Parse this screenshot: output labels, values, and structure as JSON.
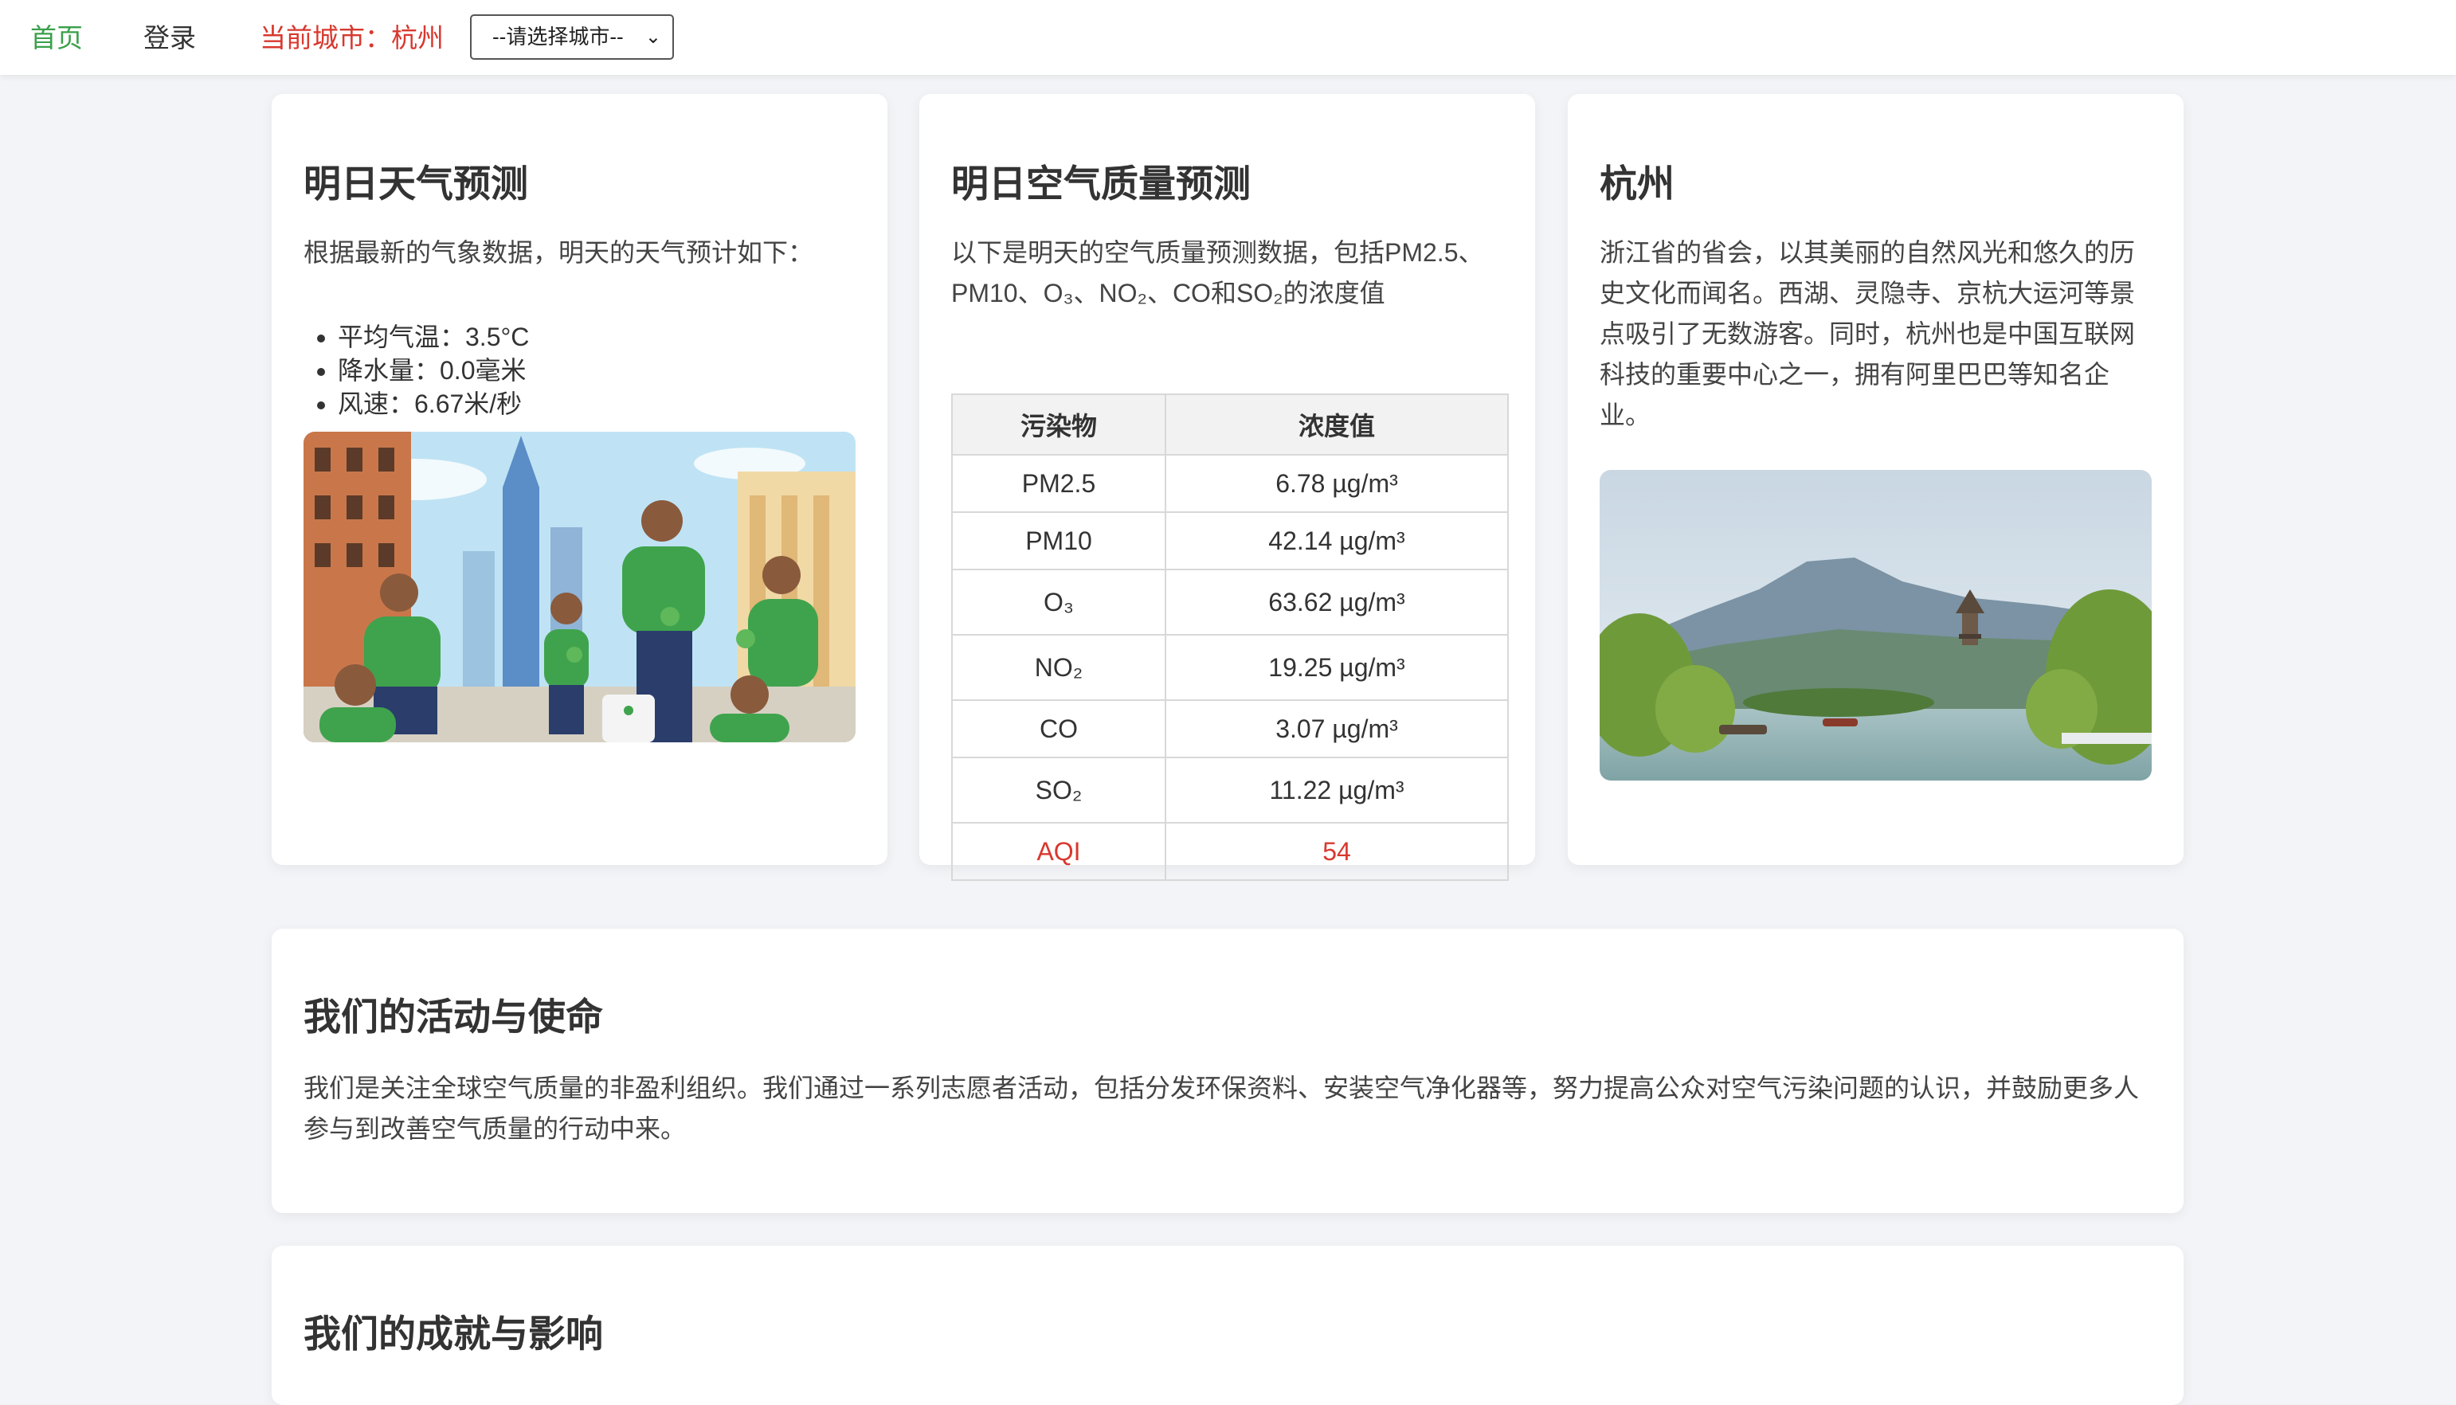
{
  "nav": {
    "home": "首页",
    "login": "登录",
    "current_city": "当前城市：杭州",
    "city_select_placeholder": "--请选择城市--"
  },
  "weather": {
    "title": "明日天气预测",
    "intro": "根据最新的气象数据，明天的天气预计如下：",
    "items": [
      "平均气温：3.5°C",
      "降水量：0.0毫米",
      "风速：6.67米/秒"
    ]
  },
  "air": {
    "title": "明日空气质量预测",
    "intro_line1": "以下是明天的空气质量预测数据，包括PM2.5、",
    "intro_line2": "PM10、O₃、NO₂、CO和SO₂的浓度值",
    "headers": [
      "污染物",
      "浓度值"
    ],
    "rows": [
      [
        "PM2.5",
        "6.78 µg/m³"
      ],
      [
        "PM10",
        "42.14 µg/m³"
      ],
      [
        "O₃",
        "63.62 µg/m³"
      ],
      [
        "NO₂",
        "19.25 µg/m³"
      ],
      [
        "CO",
        "3.07 µg/m³"
      ],
      [
        "SO₂",
        "11.22 µg/m³"
      ],
      [
        "AQI",
        "54"
      ]
    ]
  },
  "city": {
    "title": "杭州",
    "lines": [
      "浙江省的省会，以其美丽的自然风光和悠久的历",
      "史文化而闻名。西湖、灵隐寺、京杭大运河等景",
      "点吸引了无数游客。同时，杭州也是中国互联网",
      "科技的重要中心之一，拥有阿里巴巴等知名企",
      "业。"
    ]
  },
  "mission": {
    "title": "我们的活动与使命",
    "line1": "我们是关注全球空气质量的非盈利组织。我们通过一系列志愿者活动，包括分发环保资料、安装空气净化器等，努力提高公众对空气污染问题的认识，并鼓励更多人",
    "line2": "参与到改善空气质量的行动中来。"
  },
  "achievements": {
    "title": "我们的成就与影响"
  },
  "colors": {
    "accent_green": "#3aa04a",
    "accent_red": "#d8382e",
    "background": "#f3f4f7"
  }
}
